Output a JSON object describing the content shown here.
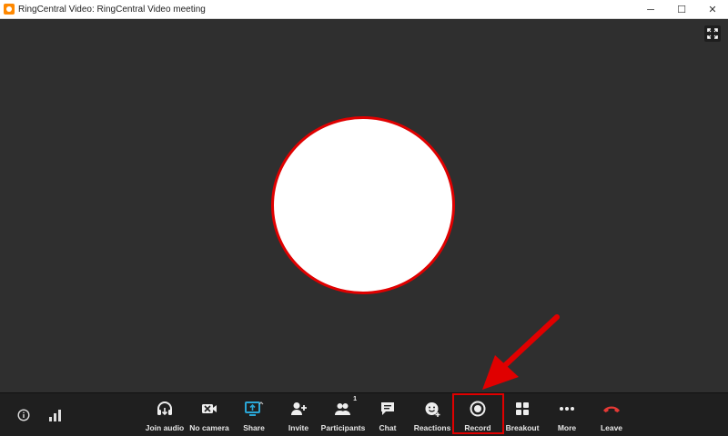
{
  "window": {
    "title": "RingCentral Video: RingCentral Video meeting",
    "controls": {
      "minimize": "─",
      "maximize": "☐",
      "close": "✕"
    }
  },
  "stage": {
    "fullscreen_icon": "expand-icon"
  },
  "toolbar": {
    "left_icons": [
      "info-icon",
      "signal-icon"
    ],
    "buttons": [
      {
        "label": "Join audio",
        "icon": "headphones-icon"
      },
      {
        "label": "No camera",
        "icon": "camera-off-icon"
      },
      {
        "label": "Share",
        "icon": "screen-share-icon"
      },
      {
        "label": "Invite",
        "icon": "add-person-icon"
      },
      {
        "label": "Participants",
        "icon": "participants-icon",
        "badge": "1"
      },
      {
        "label": "Chat",
        "icon": "chat-icon"
      },
      {
        "label": "Reactions",
        "icon": "reaction-icon"
      },
      {
        "label": "Record",
        "icon": "record-icon"
      },
      {
        "label": "Breakout",
        "icon": "breakout-icon"
      },
      {
        "label": "More",
        "icon": "more-icon"
      },
      {
        "label": "Leave",
        "icon": "phone-hangup-icon"
      }
    ]
  },
  "colors": {
    "accent_share": "#2aa6d6",
    "leave_red": "#e53935",
    "highlight_red": "#e00000"
  }
}
